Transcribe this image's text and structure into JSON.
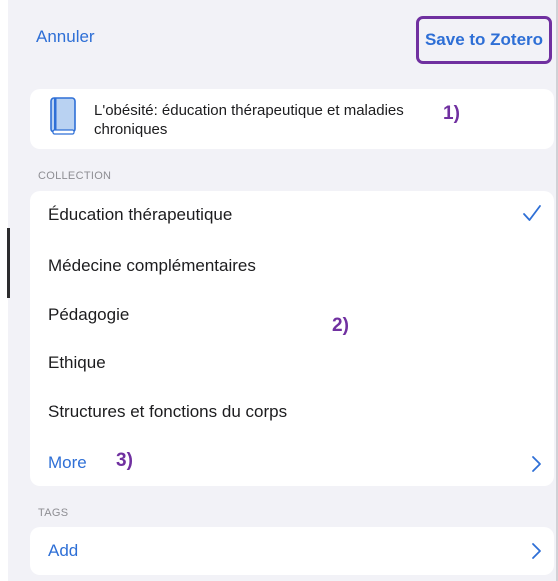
{
  "nav": {
    "cancel_label": "Annuler",
    "save_label": "Save to Zotero"
  },
  "item": {
    "icon": "book-icon",
    "title": "L'obésité: éducation thérapeutique et maladies chroniques"
  },
  "annotations": {
    "one": "1)",
    "two": "2)",
    "three": "3)"
  },
  "collection": {
    "header": "COLLECTION",
    "items": [
      {
        "label": "Éducation thérapeutique",
        "selected": true
      },
      {
        "label": "Médecine complémentaires",
        "selected": false
      },
      {
        "label": "Pédagogie",
        "selected": false
      },
      {
        "label": "Ethique",
        "selected": false
      },
      {
        "label": "Structures et fonctions du corps",
        "selected": false
      }
    ],
    "more_label": "More"
  },
  "tags": {
    "header": "TAGS",
    "add_label": "Add"
  },
  "colors": {
    "accent": "#2e6fd6",
    "highlight": "#7030a0",
    "background": "#f2f2f7"
  }
}
